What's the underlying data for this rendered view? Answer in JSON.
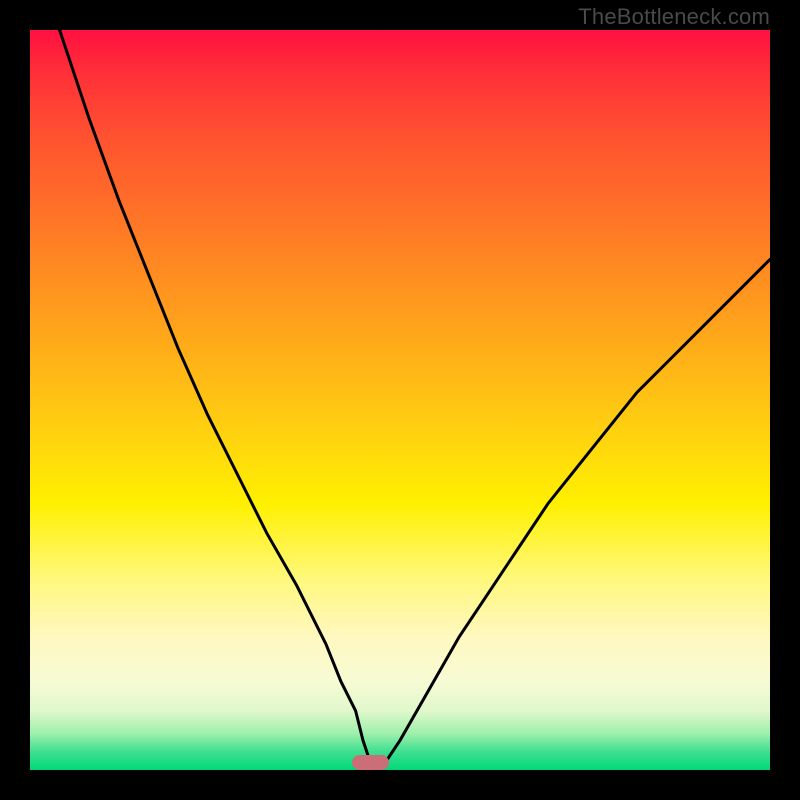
{
  "watermark": "TheBottleneck.com",
  "chart_data": {
    "type": "line",
    "title": "",
    "xlabel": "",
    "ylabel": "",
    "xlim": [
      0,
      100
    ],
    "ylim": [
      0,
      100
    ],
    "grid": false,
    "series": [
      {
        "name": "curve",
        "x": [
          4,
          8,
          12,
          16,
          20,
          24,
          28,
          32,
          36,
          40,
          42,
          44,
          45,
          46,
          48,
          50,
          54,
          58,
          62,
          66,
          70,
          74,
          78,
          82,
          86,
          90,
          94,
          98,
          100
        ],
        "y": [
          100,
          88,
          77,
          67,
          57,
          48,
          40,
          32,
          25,
          17,
          12,
          8,
          4,
          1,
          1,
          4,
          11,
          18,
          24,
          30,
          36,
          41,
          46,
          51,
          55,
          59,
          63,
          67,
          69
        ]
      }
    ],
    "marker": {
      "x": 46,
      "width": 5,
      "height": 2,
      "color": "#cc6e78"
    },
    "background_gradient": {
      "stops": [
        {
          "pos": 0,
          "color": "#ff1040"
        },
        {
          "pos": 64,
          "color": "#fff000"
        },
        {
          "pos": 100,
          "color": "#00d878"
        }
      ]
    }
  }
}
